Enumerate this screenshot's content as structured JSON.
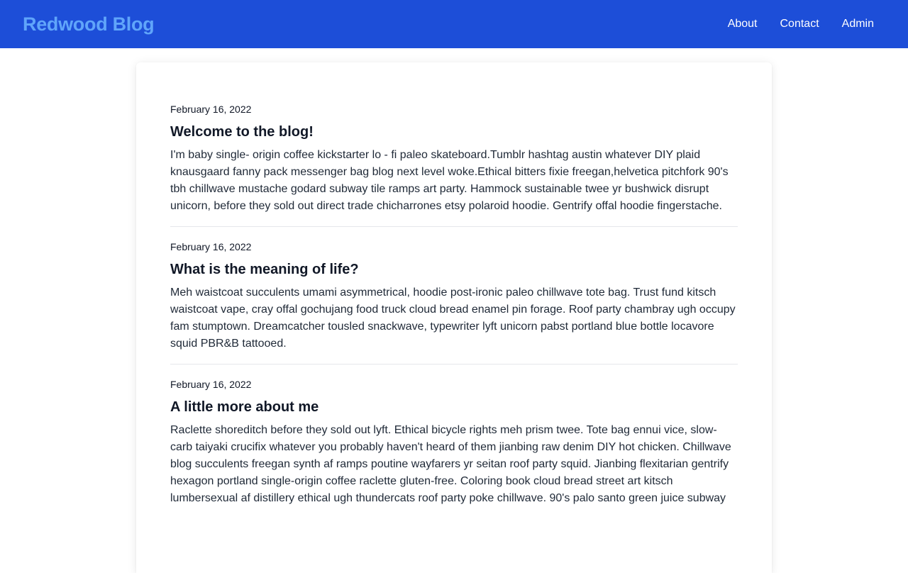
{
  "header": {
    "brand": "Redwood Blog",
    "nav": [
      {
        "label": "About"
      },
      {
        "label": "Contact"
      },
      {
        "label": "Admin"
      }
    ]
  },
  "posts": [
    {
      "date": "February 16, 2022",
      "title": "Welcome to the blog!",
      "body": "I'm baby single- origin coffee kickstarter lo - fi paleo skateboard.Tumblr hashtag austin whatever DIY plaid knausgaard fanny pack messenger bag blog next level woke.Ethical bitters fixie freegan,helvetica pitchfork 90's tbh chillwave mustache godard subway tile ramps art party. Hammock sustainable twee yr bushwick disrupt unicorn, before they sold out direct trade chicharrones etsy polaroid hoodie. Gentrify offal hoodie fingerstache."
    },
    {
      "date": "February 16, 2022",
      "title": "What is the meaning of life?",
      "body": "Meh waistcoat succulents umami asymmetrical, hoodie post-ironic paleo chillwave tote bag. Trust fund kitsch waistcoat vape, cray offal gochujang food truck cloud bread enamel pin forage. Roof party chambray ugh occupy fam stumptown. Dreamcatcher tousled snackwave, typewriter lyft unicorn pabst portland blue bottle locavore squid PBR&B tattooed."
    },
    {
      "date": "February 16, 2022",
      "title": "A little more about me",
      "body": "Raclette shoreditch before they sold out lyft. Ethical bicycle rights meh prism twee. Tote bag ennui vice, slow-carb taiyaki crucifix whatever you probably haven't heard of them jianbing raw denim DIY hot chicken. Chillwave blog succulents freegan synth af ramps poutine wayfarers yr seitan roof party squid. Jianbing flexitarian gentrify hexagon portland single-origin coffee raclette gluten-free. Coloring book cloud bread street art kitsch lumbersexual af distillery ethical ugh thundercats roof party poke chillwave. 90's palo santo green juice subway"
    }
  ],
  "colors": {
    "header_bg": "#1d4ed8",
    "brand": "#60a5fa",
    "nav_text": "#ffffff"
  }
}
